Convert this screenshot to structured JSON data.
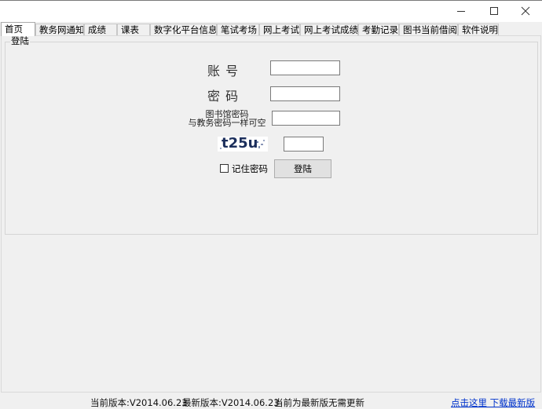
{
  "window": {
    "minimize_label": "minimize",
    "maximize_label": "maximize",
    "close_label": "close"
  },
  "tabs": [
    {
      "label": "首页",
      "active": true
    },
    {
      "label": "教务网通知",
      "active": false
    },
    {
      "label": "成绩",
      "active": false
    },
    {
      "label": "课表",
      "active": false
    },
    {
      "label": "数字化平台信息",
      "active": false
    },
    {
      "label": "笔试考场",
      "active": false
    },
    {
      "label": "网上考试",
      "active": false
    },
    {
      "label": "网上考试成绩",
      "active": false
    },
    {
      "label": "考勤记录",
      "active": false
    },
    {
      "label": "图书当前借阅",
      "active": false
    },
    {
      "label": "软件说明",
      "active": false
    }
  ],
  "login": {
    "group_title": "登陆",
    "account_label": "账 号",
    "account_value": "",
    "password_label": "密 码",
    "password_value": "",
    "library_label_line1": "图书馆密码",
    "library_label_line2": "与教务密码一样可空",
    "library_value": "",
    "captcha_text": "t25u",
    "captcha_value": "",
    "remember_label": "记住密码",
    "remember_checked": false,
    "login_button": "登陆"
  },
  "status": {
    "current_version": "当前版本:V2014.06.23",
    "latest_version": "最新版本:V2014.06.23",
    "update_message": "当前为最新版无需更新",
    "download_link": "点击这里 下载最新版"
  }
}
